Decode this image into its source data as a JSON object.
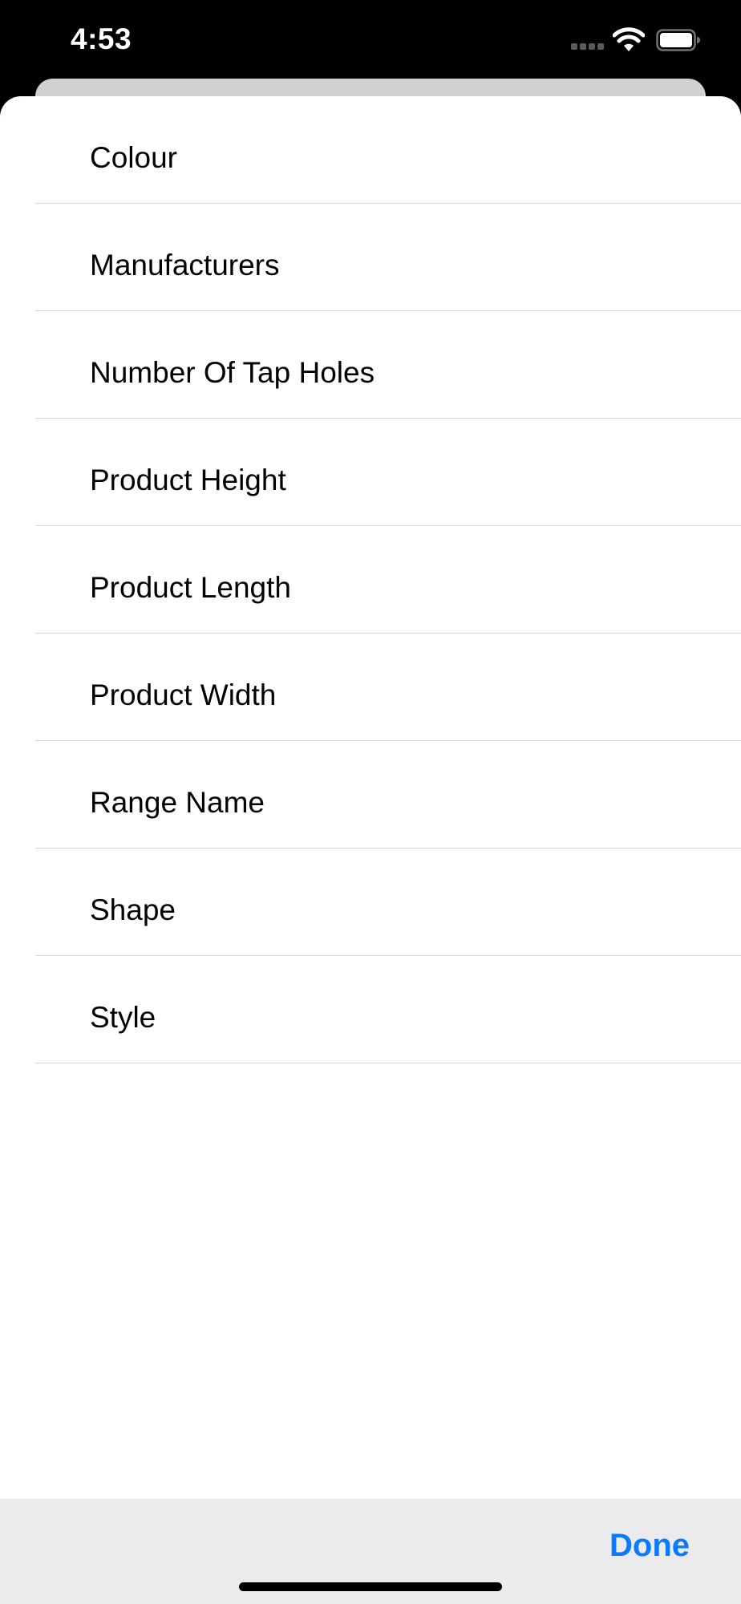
{
  "status_bar": {
    "time": "4:53"
  },
  "options": [
    {
      "label": "Colour"
    },
    {
      "label": "Manufacturers"
    },
    {
      "label": "Number Of Tap Holes"
    },
    {
      "label": "Product Height"
    },
    {
      "label": "Product Length"
    },
    {
      "label": "Product Width"
    },
    {
      "label": "Range Name"
    },
    {
      "label": "Shape"
    },
    {
      "label": "Style"
    }
  ],
  "toolbar": {
    "done_label": "Done"
  },
  "colors": {
    "accent": "#0a7aff",
    "toolbar_background": "#ebebed",
    "separator": "#d6d6d8"
  },
  "icons": {
    "signal": "cellular-signal-icon",
    "wifi": "wifi-icon",
    "battery": "battery-icon"
  }
}
